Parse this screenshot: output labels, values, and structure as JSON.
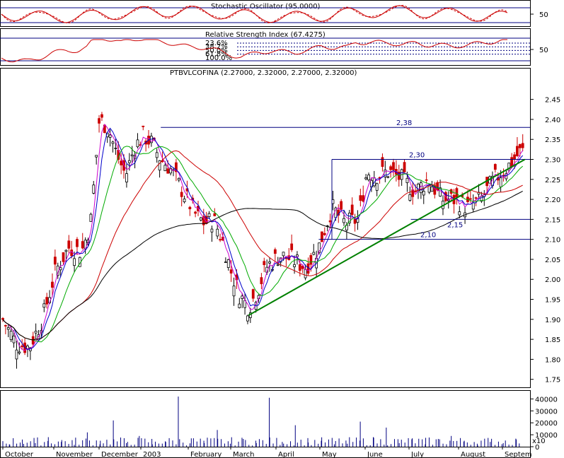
{
  "chart_data": {
    "type": "candlestick",
    "panels": {
      "stochastic": {
        "title": "Stochastic Oscillator (95.0000)",
        "axis_label": "50"
      },
      "rsi": {
        "title": "Relative Strength Index (67.4275)",
        "axis_label": "50",
        "fib_labels": [
          "23.6%",
          "38.2%",
          "50.0%",
          "61.8%",
          "100.0%"
        ]
      },
      "price": {
        "title": "PTBVLCOFINA (2.27000, 2.32000, 2.27000, 2.32000)",
        "y_ticks": [
          "2.45",
          "2.40",
          "2.35",
          "2.30",
          "2.25",
          "2.20",
          "2.15",
          "2.10",
          "2.05",
          "2.00",
          "1.95",
          "1.90",
          "1.85",
          "1.80",
          "1.75"
        ],
        "ylim": [
          1.73,
          2.49
        ],
        "levels": [
          {
            "value": 2.38,
            "label": "2,38"
          },
          {
            "value": 2.3,
            "label": "2,30"
          },
          {
            "value": 2.15,
            "label": "2,15"
          },
          {
            "value": 2.1,
            "label": "2,10"
          }
        ],
        "trendline": {
          "from": {
            "month_index": 5.6,
            "value": 1.91
          },
          "to": {
            "month_index": 11.9,
            "value": 2.3
          }
        },
        "price_path": [
          [
            0.0,
            1.9
          ],
          [
            0.3,
            1.84
          ],
          [
            0.6,
            1.83
          ],
          [
            0.9,
            1.9
          ],
          [
            1.2,
            2.02
          ],
          [
            1.5,
            2.08
          ],
          [
            1.8,
            2.07
          ],
          [
            2.0,
            2.14
          ],
          [
            2.2,
            2.4
          ],
          [
            2.4,
            2.38
          ],
          [
            2.6,
            2.31
          ],
          [
            2.8,
            2.26
          ],
          [
            3.0,
            2.33
          ],
          [
            3.2,
            2.36
          ],
          [
            3.4,
            2.34
          ],
          [
            3.6,
            2.3
          ],
          [
            3.8,
            2.28
          ],
          [
            4.0,
            2.24
          ],
          [
            4.2,
            2.2
          ],
          [
            4.4,
            2.16
          ],
          [
            4.6,
            2.14
          ],
          [
            4.8,
            2.15
          ],
          [
            5.0,
            2.1
          ],
          [
            5.2,
            2.02
          ],
          [
            5.4,
            1.96
          ],
          [
            5.6,
            1.93
          ],
          [
            5.8,
            1.97
          ],
          [
            6.0,
            2.03
          ],
          [
            6.3,
            2.06
          ],
          [
            6.6,
            2.05
          ],
          [
            6.9,
            2.03
          ],
          [
            7.2,
            2.08
          ],
          [
            7.5,
            2.18
          ],
          [
            7.8,
            2.14
          ],
          [
            8.1,
            2.15
          ],
          [
            8.3,
            2.27
          ],
          [
            8.5,
            2.26
          ],
          [
            8.8,
            2.27
          ],
          [
            9.1,
            2.25
          ],
          [
            9.4,
            2.22
          ],
          [
            9.7,
            2.25
          ],
          [
            10.0,
            2.2
          ],
          [
            10.3,
            2.2
          ],
          [
            10.6,
            2.18
          ],
          [
            10.9,
            2.2
          ],
          [
            11.2,
            2.25
          ],
          [
            11.5,
            2.28
          ],
          [
            11.8,
            2.32
          ]
        ]
      },
      "volume": {
        "y_ticks": [
          "40000",
          "30000",
          "20000",
          "10000",
          "0"
        ],
        "scale_label": "x10",
        "bars": [
          2000,
          6000,
          3000,
          8000,
          4000,
          1500,
          12000,
          5000,
          22000,
          3000,
          9000,
          2000,
          4500,
          42000,
          7000,
          3000,
          14000,
          2500,
          6500,
          3000,
          41000,
          4000,
          18000,
          3500,
          5000,
          2000,
          2500,
          21000,
          8000,
          16000,
          3000,
          7000,
          2000,
          6500,
          9000,
          5000,
          2500,
          4000,
          3000,
          6000
        ]
      }
    },
    "x_labels": [
      "October",
      "November",
      "December",
      "2003",
      "February",
      "March",
      "April",
      "May",
      "June",
      "July",
      "August",
      "Septem"
    ],
    "series": [
      {
        "name": "price",
        "color": "#cc0000"
      },
      {
        "color": "#0000cc"
      },
      {
        "color": "#cc00cc"
      },
      {
        "color": "#00aa00"
      },
      {
        "color": "#cc0000"
      },
      {
        "color": "#000000"
      }
    ],
    "trendline_color": "#008000",
    "grid": false
  }
}
